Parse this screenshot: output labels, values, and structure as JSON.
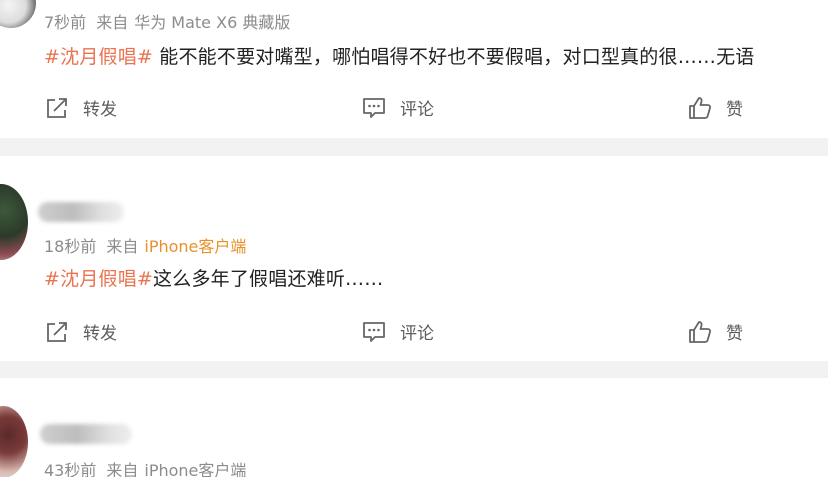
{
  "posts": [
    {
      "time": "7秒前",
      "source_prefix": "来自",
      "device": "华为 Mate X6 典藏版",
      "device_color": "#8c8c8c",
      "hashtag": "#沈月假唱#",
      "text": " 能不能不要对嘴型，哪怕唱得不好也不要假唱，对口型真的很……无语",
      "actions": {
        "repost": "转发",
        "comment": "评论",
        "like": "赞"
      }
    },
    {
      "time": "18秒前",
      "source_prefix": "来自",
      "device": "iPhone客户端",
      "device_color": "#e8912a",
      "hashtag": "#沈月假唱#",
      "text": "这么多年了假唱还难听……",
      "actions": {
        "repost": "转发",
        "comment": "评论",
        "like": "赞"
      }
    },
    {
      "time": "43秒前",
      "source_prefix": "来自",
      "device": "iPhone客户端",
      "device_color": "#8c8c8c"
    }
  ],
  "icons": {
    "repost": "share-icon",
    "comment": "comment-icon",
    "like": "thumbs-up-icon"
  },
  "colors": {
    "hashtag": "#eb7350",
    "source_link": "#e8912a",
    "meta": "#8c8c8c",
    "background": "#f2f2f2"
  }
}
